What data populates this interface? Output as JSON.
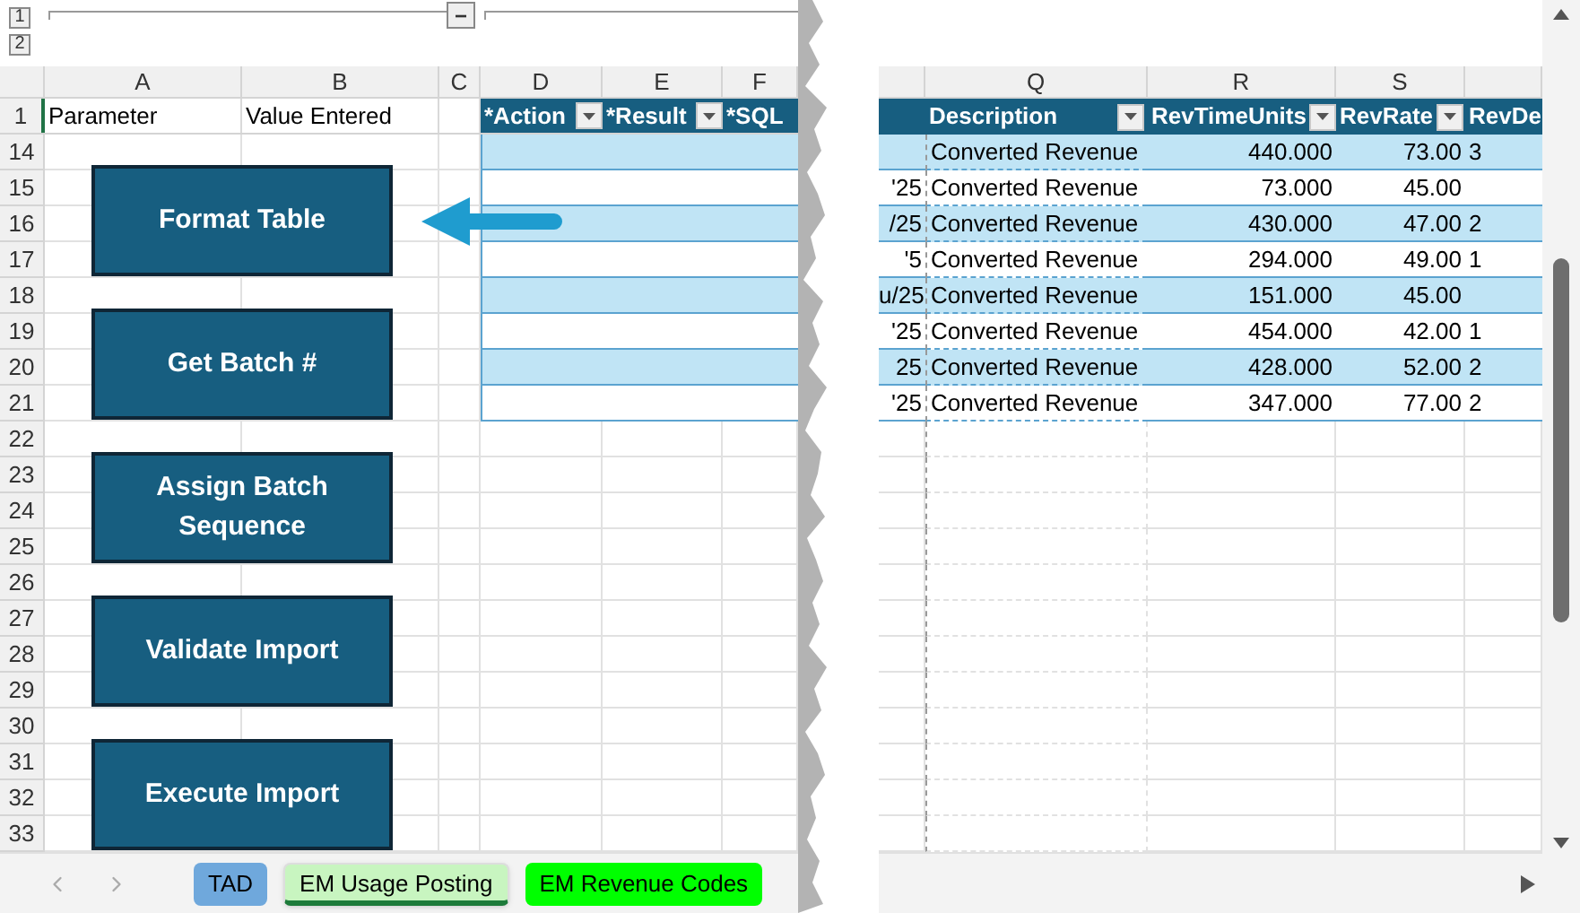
{
  "outline": {
    "levels": [
      "1",
      "2"
    ],
    "collapse_symbol": "−"
  },
  "left_pane": {
    "column_letters": [
      "A",
      "B",
      "C",
      "D",
      "E",
      "F"
    ],
    "header_row_number": "1",
    "header_cells": [
      "Parameter",
      "Value Entered"
    ],
    "table_headers": [
      "*Action",
      "*Result",
      "*SQL"
    ],
    "row_numbers": [
      "14",
      "15",
      "16",
      "17",
      "18",
      "19",
      "20",
      "21",
      "22",
      "23",
      "24",
      "25",
      "26",
      "27",
      "28",
      "29",
      "30",
      "31",
      "32",
      "33"
    ]
  },
  "macro_buttons": [
    "Format Table",
    "Get Batch #",
    "Assign Batch Sequence",
    "Validate Import",
    "Execute Import"
  ],
  "right_pane": {
    "column_letters": [
      "Q",
      "R",
      "S"
    ],
    "table_headers": [
      "Description",
      "RevTimeUnits",
      "RevRate",
      "RevDe"
    ],
    "rows": [
      {
        "column_p": "",
        "description": "Converted Revenue",
        "rev_time_units": "440.000",
        "rev_rate": "73.00",
        "column_t": "3"
      },
      {
        "column_p": "'25",
        "description": "Converted Revenue",
        "rev_time_units": "73.000",
        "rev_rate": "45.00",
        "column_t": ""
      },
      {
        "column_p": "/25",
        "description": "Converted Revenue",
        "rev_time_units": "430.000",
        "rev_rate": "47.00",
        "column_t": "2"
      },
      {
        "column_p": "'5",
        "description": "Converted Revenue",
        "rev_time_units": "294.000",
        "rev_rate": "49.00",
        "column_t": "1"
      },
      {
        "column_p": "u/25",
        "description": "Converted Revenue",
        "rev_time_units": "151.000",
        "rev_rate": "45.00",
        "column_t": ""
      },
      {
        "column_p": "'25",
        "description": "Converted Revenue",
        "rev_time_units": "454.000",
        "rev_rate": "42.00",
        "column_t": "1"
      },
      {
        "column_p": "25",
        "description": "Converted Revenue",
        "rev_time_units": "428.000",
        "rev_rate": "52.00",
        "column_t": "2"
      },
      {
        "column_p": "'25",
        "description": "Converted Revenue",
        "rev_time_units": "347.000",
        "rev_rate": "77.00",
        "column_t": "2"
      }
    ]
  },
  "sheet_tabs": [
    {
      "label": "TAD",
      "selected": false,
      "color": "#6fa8dc"
    },
    {
      "label": "EM Usage Posting",
      "selected": true,
      "color": "#c8f5c0"
    },
    {
      "label": "EM Revenue Codes",
      "selected": false,
      "color": "#00ff00"
    }
  ]
}
